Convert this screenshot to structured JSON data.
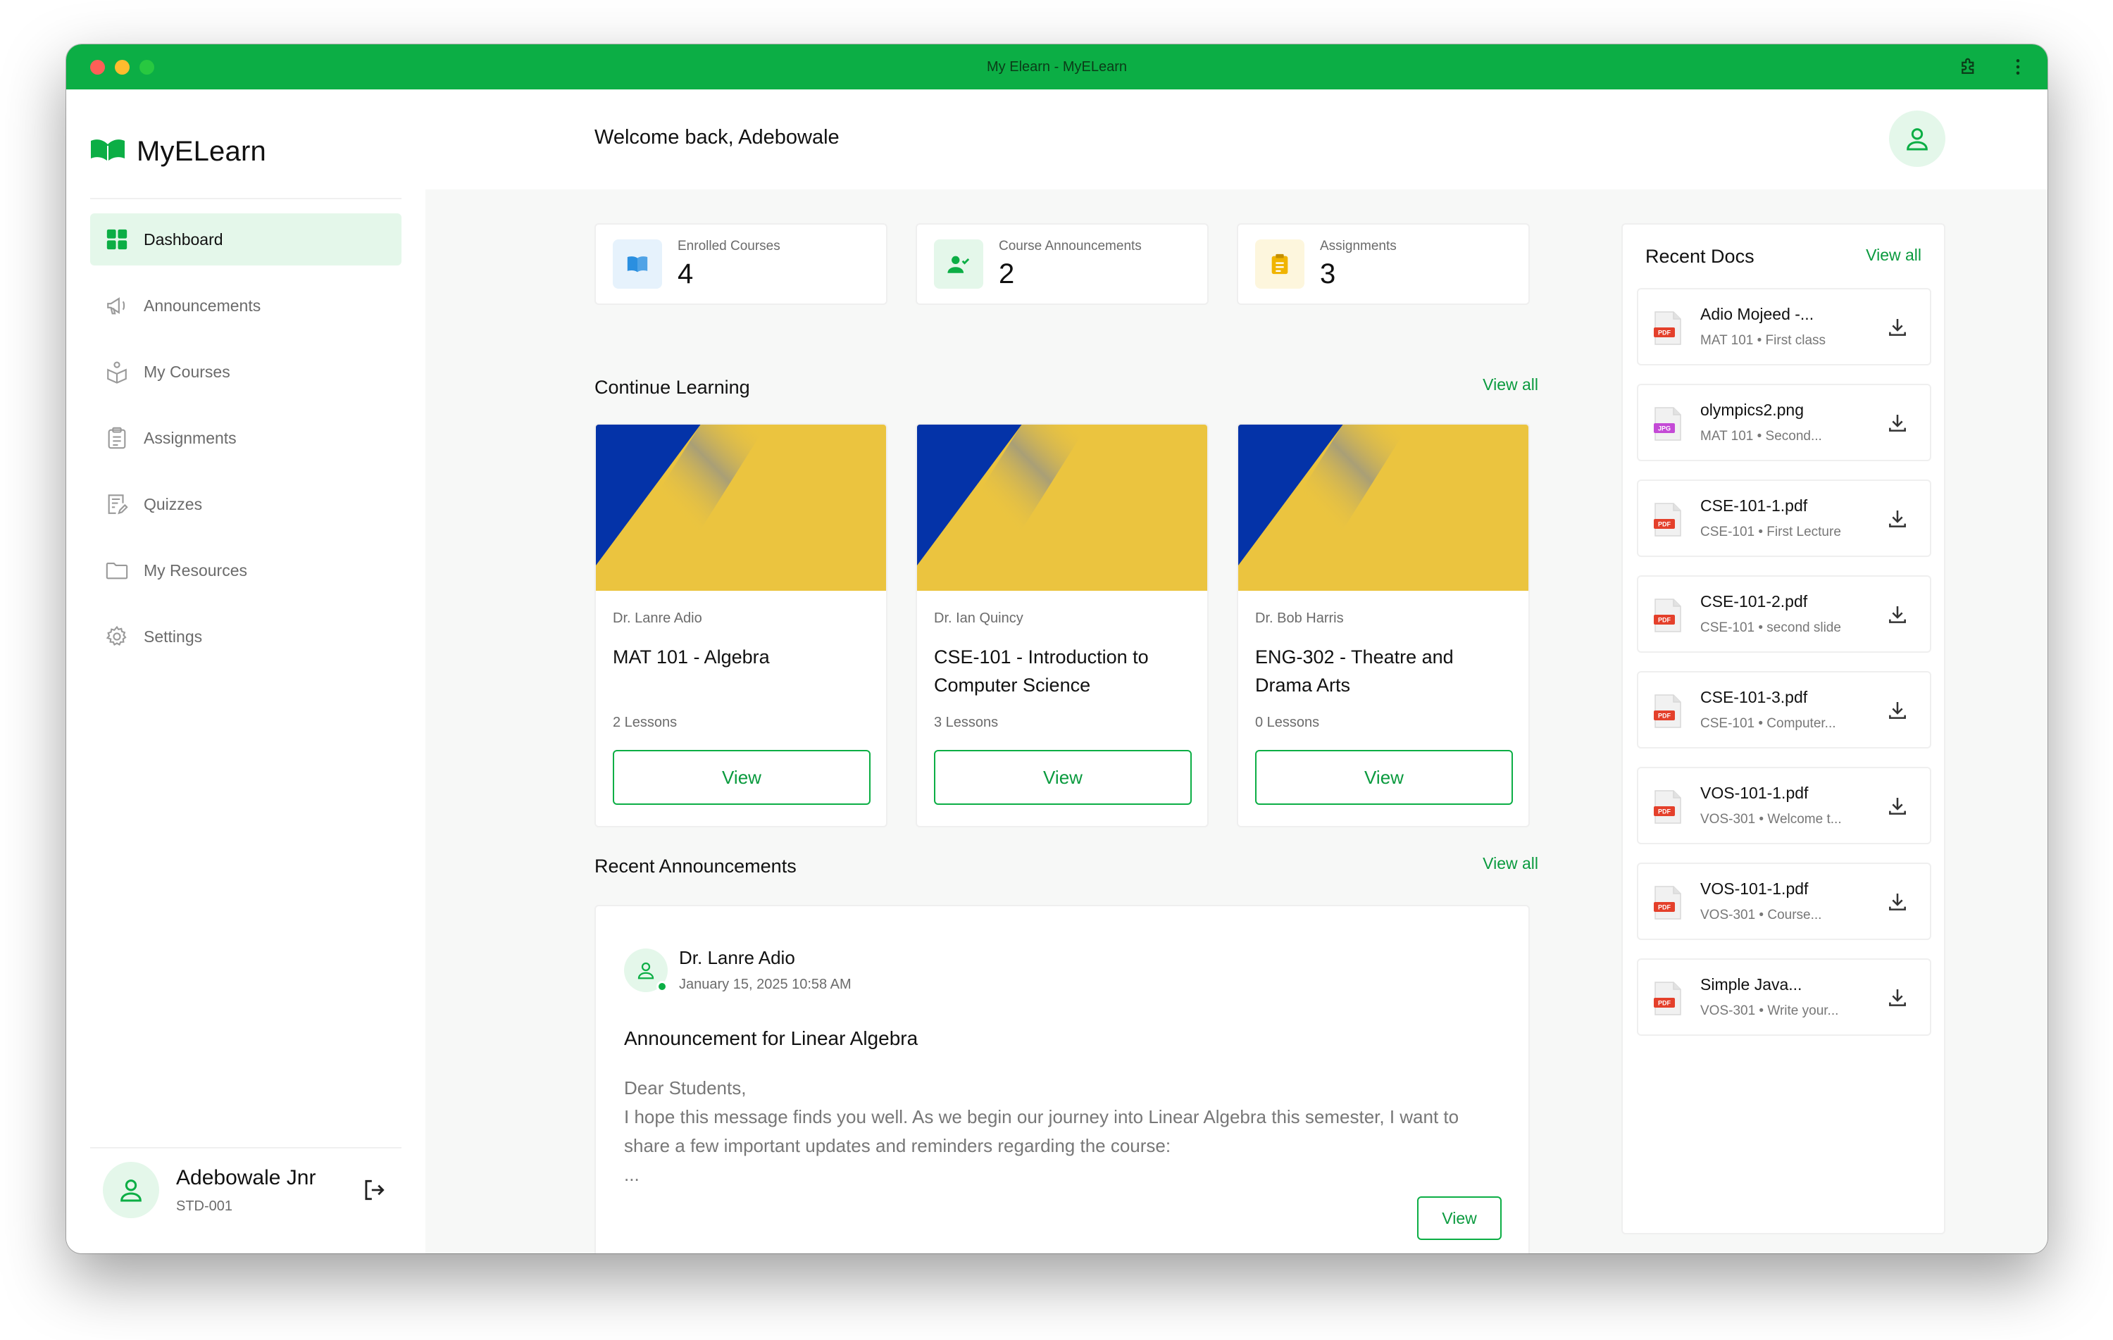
{
  "window": {
    "title": "My Elearn - MyELearn"
  },
  "brand": {
    "name": "MyELearn"
  },
  "sidebar": {
    "items": [
      {
        "label": "Dashboard",
        "icon": "grid-icon",
        "active": true
      },
      {
        "label": "Announcements",
        "icon": "megaphone-icon"
      },
      {
        "label": "My Courses",
        "icon": "courses-icon"
      },
      {
        "label": "Assignments",
        "icon": "clipboard-icon"
      },
      {
        "label": "Quizzes",
        "icon": "quiz-icon"
      },
      {
        "label": "My Resources",
        "icon": "folder-icon"
      },
      {
        "label": "Settings",
        "icon": "gear-icon"
      }
    ]
  },
  "user": {
    "name": "Adebowale Jnr",
    "id": "STD-001"
  },
  "header": {
    "welcome": "Welcome back, Adebowale"
  },
  "stats": [
    {
      "label": "Enrolled Courses",
      "value": "4",
      "icon": "book-icon",
      "color": "#2a8fe0",
      "bg": "#e6f2fc"
    },
    {
      "label": "Course Announcements",
      "value": "2",
      "icon": "user-check-icon",
      "color": "#0cae45",
      "bg": "#e4f7ea"
    },
    {
      "label": "Assignments",
      "value": "3",
      "icon": "clipboard-icon",
      "color": "#f0b400",
      "bg": "#fdf6dd"
    }
  ],
  "continue_learning": {
    "title": "Continue Learning",
    "view_all": "View all",
    "courses": [
      {
        "instructor": "Dr. Lanre Adio",
        "title": "MAT 101 - Algebra",
        "lessons": "2 Lessons",
        "button": "View"
      },
      {
        "instructor": "Dr. Ian Quincy",
        "title": "CSE-101 - Introduction to Computer Science",
        "lessons": "3 Lessons",
        "button": "View"
      },
      {
        "instructor": "Dr. Bob Harris",
        "title": "ENG-302 - Theatre and Drama Arts",
        "lessons": "0 Lessons",
        "button": "View"
      }
    ]
  },
  "recent_announcements": {
    "title": "Recent Announcements",
    "view_all": "View all",
    "item": {
      "author": "Dr. Lanre Adio",
      "date": "January 15, 2025 10:58 AM",
      "title": "Announcement for Linear Algebra",
      "greeting": "Dear Students,",
      "body": "I hope this message finds you well.  As we begin our journey into Linear Algebra this semester, I want to share a few important updates and reminders regarding the course:",
      "ellipsis": "...",
      "button": "View"
    }
  },
  "recent_docs": {
    "title": "Recent Docs",
    "view_all": "View all",
    "items": [
      {
        "name": "Adio Mojeed -...",
        "meta": "MAT 101 • First class",
        "type": "PDF"
      },
      {
        "name": "olympics2.png",
        "meta": "MAT 101 • Second...",
        "type": "JPG"
      },
      {
        "name": "CSE-101-1.pdf",
        "meta": "CSE-101 • First Lecture",
        "type": "PDF"
      },
      {
        "name": "CSE-101-2.pdf",
        "meta": "CSE-101 • second slide",
        "type": "PDF"
      },
      {
        "name": "CSE-101-3.pdf",
        "meta": "CSE-101 • Computer...",
        "type": "PDF"
      },
      {
        "name": "VOS-101-1.pdf",
        "meta": "VOS-301 • Welcome t...",
        "type": "PDF"
      },
      {
        "name": "VOS-101-1.pdf",
        "meta": "VOS-301 • Course...",
        "type": "PDF"
      },
      {
        "name": "Simple Java...",
        "meta": "VOS-301 • Write your...",
        "type": "PDF"
      }
    ]
  },
  "colors": {
    "accent": "#0cae45",
    "banner_blue": "#0433a8",
    "banner_yellow": "#ebc43f"
  }
}
